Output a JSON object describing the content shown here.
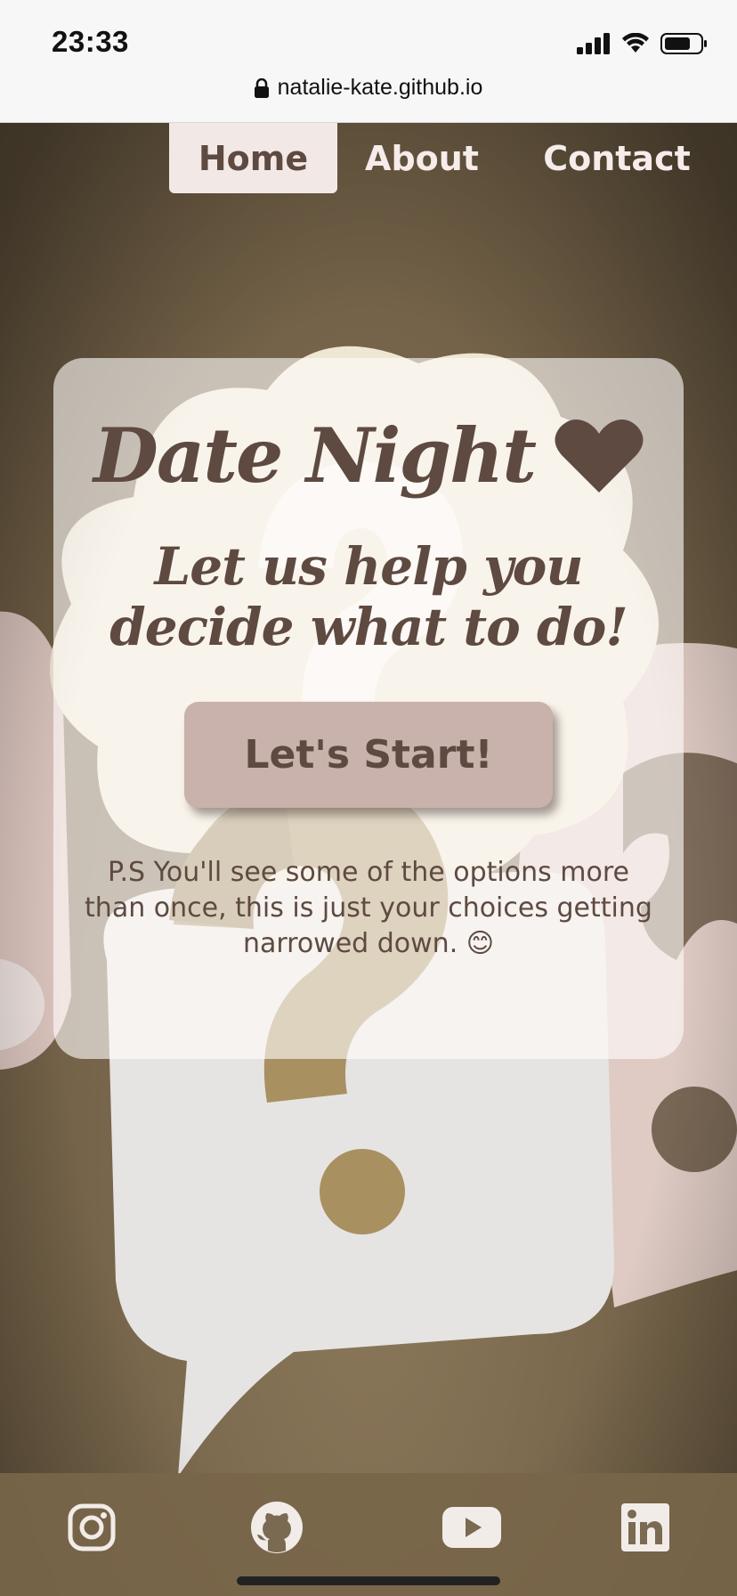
{
  "status_bar": {
    "time": "23:33",
    "url": "natalie-kate.github.io",
    "icons": [
      "signal-icon",
      "wifi-icon",
      "battery-icon",
      "lock-icon"
    ]
  },
  "nav": {
    "items": [
      {
        "label": "Home",
        "active": true
      },
      {
        "label": "About",
        "active": false
      },
      {
        "label": "Contact",
        "active": false
      }
    ]
  },
  "card": {
    "title": "Date Night",
    "title_icon": "heart-icon",
    "subtitle": "Let us help you decide what to do!",
    "button_label": "Let's Start!",
    "note": "P.S You'll see some of the options more than once, this is just your choices getting narrowed down. 😊"
  },
  "footer": {
    "social": [
      "instagram-icon",
      "github-icon",
      "youtube-icon",
      "linkedin-icon"
    ]
  },
  "colors": {
    "text": "#5e4a40",
    "button": "#c8b2ab",
    "nav_active_bg": "#f2e9e7",
    "background": "#7d6b50"
  }
}
